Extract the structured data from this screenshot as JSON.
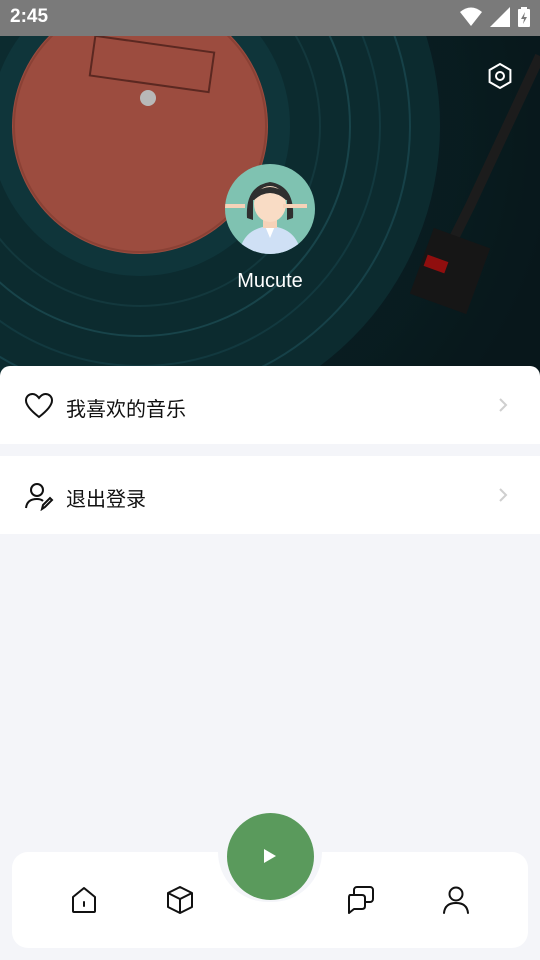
{
  "status_bar": {
    "time": "2:45"
  },
  "profile": {
    "username": "Mucute"
  },
  "menu": {
    "items": [
      {
        "label": "我喜欢的音乐",
        "icon": "heart-icon"
      },
      {
        "label": "退出登录",
        "icon": "user-edit-icon"
      }
    ]
  },
  "bottom_nav": {
    "items": [
      {
        "icon": "home-icon"
      },
      {
        "icon": "cube-icon"
      },
      {
        "icon": "play-icon"
      },
      {
        "icon": "chat-icon"
      },
      {
        "icon": "person-icon"
      }
    ]
  },
  "colors": {
    "accent": "#5a9a5c",
    "background": "#f4f5f9"
  }
}
